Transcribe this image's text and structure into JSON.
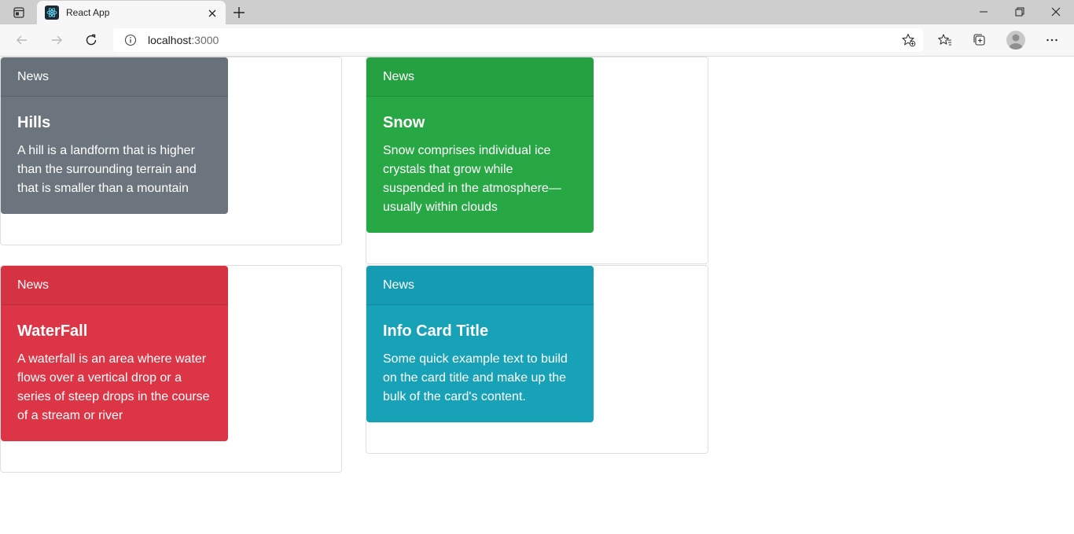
{
  "browser": {
    "tab_title": "React App",
    "url_host": "localhost",
    "url_port": ":3000"
  },
  "cards": [
    {
      "header": "News",
      "title": "Hills",
      "text": "A hill is a landform that is higher than the surrounding terrain and that is smaller than a mountain",
      "color": "#6c757d"
    },
    {
      "header": "News",
      "title": "Snow",
      "text": "Snow comprises individual ice crystals that grow while suspended in the atmosphere—usually within clouds",
      "color": "#28a745"
    },
    {
      "header": "News",
      "title": "WaterFall",
      "text": "A waterfall is an area where water flows over a vertical drop or a series of steep drops in the course of a stream or river",
      "color": "#dc3545"
    },
    {
      "header": "News",
      "title": "Info Card Title",
      "text": "Some quick example text to build on the card title and make up the bulk of the card's content.",
      "color": "#17a2b8"
    }
  ]
}
